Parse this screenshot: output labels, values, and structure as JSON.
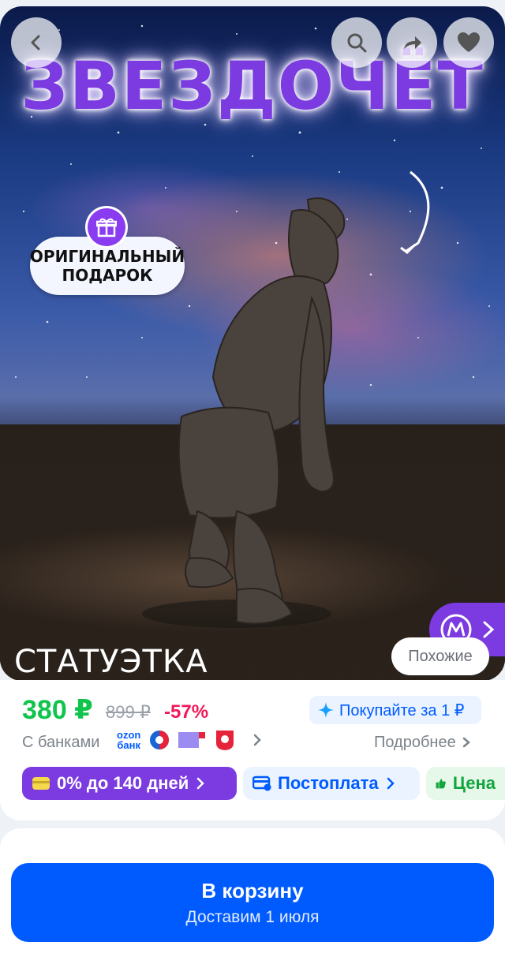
{
  "hero": {
    "title": "ЗВЕЗДОЧЁТ",
    "gift_badge": [
      "ОРИГИНАЛЬНЫЙ",
      "ПОДАРОК"
    ],
    "bottom_label": "СТАТУЭТКА",
    "similar_label": "Похожие",
    "icons": [
      "back-icon",
      "search-icon",
      "share-icon",
      "heart-icon",
      "gift-icon",
      "arrow-curve-icon",
      "m-logo-icon",
      "chevron-right-icon"
    ]
  },
  "price": {
    "current": "380 ₽",
    "old": "899 ₽",
    "discount": "-57%",
    "buy_for_1": "Покупайте за 1 ₽"
  },
  "banks": {
    "label": "С банками",
    "ozon_line1": "ozon",
    "ozon_line2": "банк",
    "more": "Подробнее"
  },
  "chips": [
    {
      "label": "0% до 140 дней"
    },
    {
      "label": "Постоплата"
    },
    {
      "label": "Цена"
    }
  ],
  "cart": {
    "title": "В корзину",
    "subtitle": "Доставим 1 июля"
  },
  "colors": {
    "accent": "#005bff",
    "price_green": "#10c44c",
    "discount_red": "#f01859",
    "purple": "#7b3be0"
  }
}
